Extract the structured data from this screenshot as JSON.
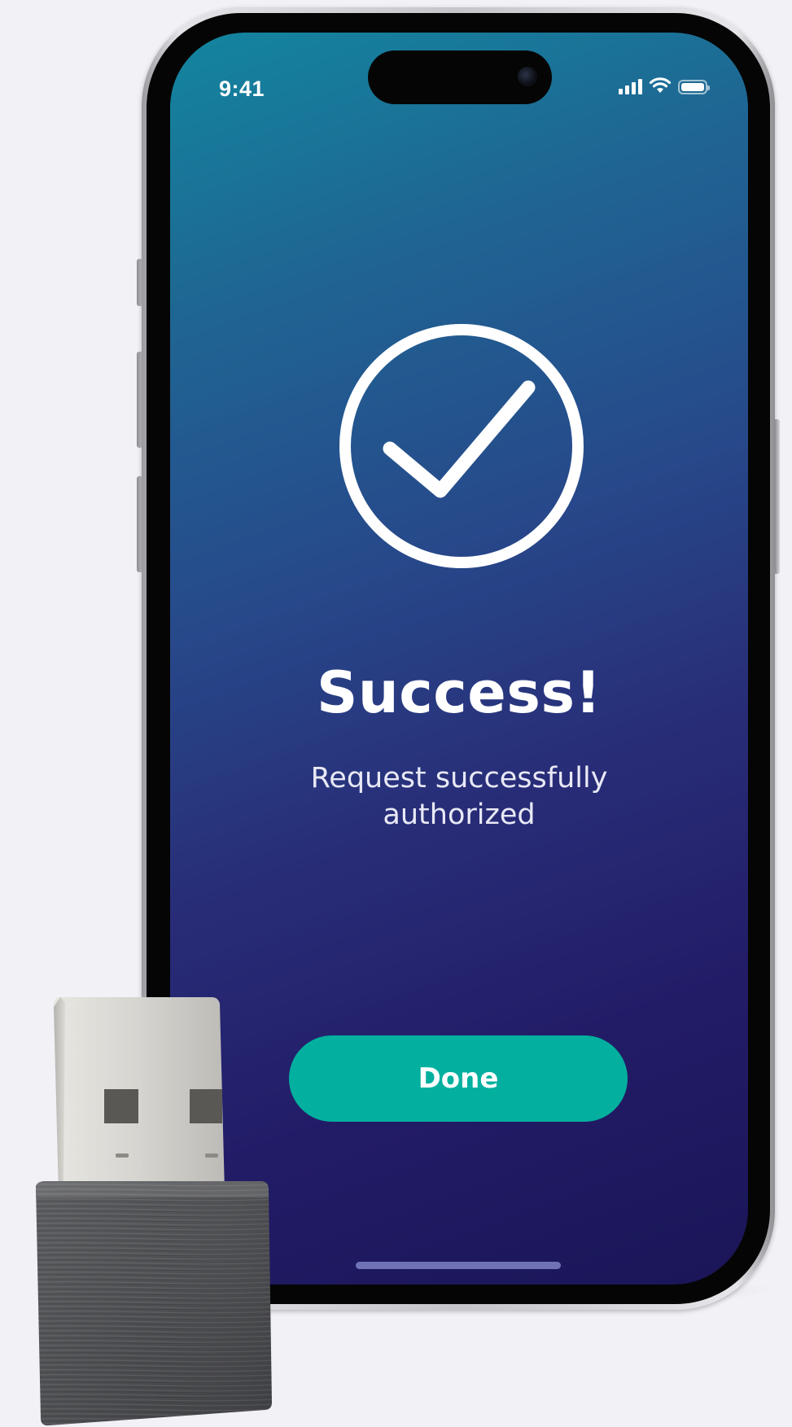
{
  "status_bar": {
    "time": "9:41"
  },
  "icons": {
    "success": "checkmark-circle-icon",
    "signal": "cellular-signal-icon",
    "wifi": "wifi-icon",
    "battery": "battery-icon"
  },
  "main": {
    "title": "Success!",
    "message": "Request successfully\nauthorized"
  },
  "actions": {
    "done_label": "Done"
  },
  "colors": {
    "button": "#03b09f",
    "gradient_top": "#13869f",
    "gradient_bottom": "#1a1658",
    "text": "#ffffff"
  }
}
